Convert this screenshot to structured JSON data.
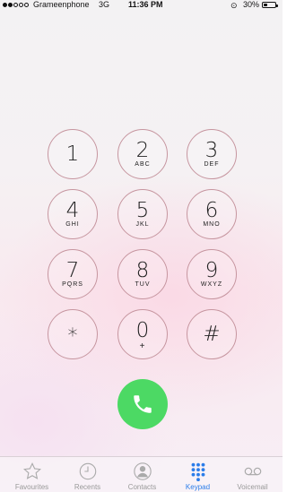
{
  "status_bar": {
    "carrier": "Grameenphone",
    "network": "3G",
    "time": "11:36 PM",
    "battery": "30%",
    "battery_level": 0.3,
    "signal_bars_filled": 2,
    "signal_bars_total": 5
  },
  "keypad": {
    "keys": [
      {
        "digit": "1",
        "letters": ""
      },
      {
        "digit": "2",
        "letters": "ABC"
      },
      {
        "digit": "3",
        "letters": "DEF"
      },
      {
        "digit": "4",
        "letters": "GHI"
      },
      {
        "digit": "5",
        "letters": "JKL"
      },
      {
        "digit": "6",
        "letters": "MNO"
      },
      {
        "digit": "7",
        "letters": "PQRS"
      },
      {
        "digit": "8",
        "letters": "TUV"
      },
      {
        "digit": "9",
        "letters": "WXYZ"
      },
      {
        "digit": "*",
        "letters": ""
      },
      {
        "digit": "0",
        "letters": "+"
      },
      {
        "digit": "#",
        "letters": ""
      }
    ]
  },
  "call_button": {
    "icon": "phone-icon",
    "color": "#4cd964"
  },
  "tabs": [
    {
      "label": "Favourites",
      "icon": "star-icon",
      "active": false
    },
    {
      "label": "Recents",
      "icon": "clock-icon",
      "active": false
    },
    {
      "label": "Contacts",
      "icon": "person-icon",
      "active": false
    },
    {
      "label": "Keypad",
      "icon": "keypad-icon",
      "active": true
    },
    {
      "label": "Voicemail",
      "icon": "voicemail-icon",
      "active": false
    }
  ],
  "colors": {
    "accent": "#2b7de9",
    "key_border": "#c6959f",
    "call_green": "#4cd964"
  }
}
